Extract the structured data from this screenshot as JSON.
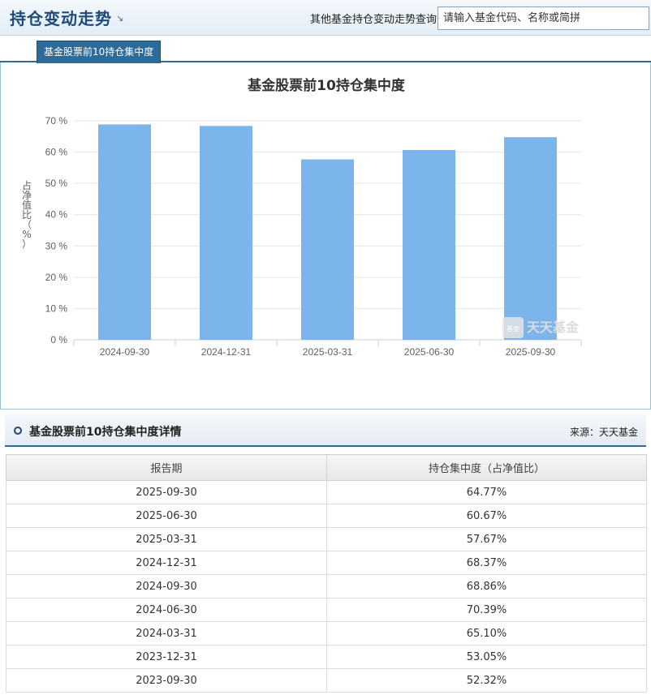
{
  "header": {
    "title": "持仓变动走势",
    "arrow": "↘",
    "query_label": "其他基金持仓变动走势查询:",
    "search_placeholder": "请输入基金代码、名称或简拼"
  },
  "tabs": [
    {
      "label": "基金股票前10持仓集中度"
    }
  ],
  "chart": {
    "watermark_text": "天天基金",
    "watermark_sub": "基金"
  },
  "chart_data": {
    "type": "bar",
    "title": "基金股票前10持仓集中度",
    "ylabel": "占净值比（%）",
    "xlabel": "",
    "categories": [
      "2024-09-30",
      "2024-12-31",
      "2025-03-31",
      "2025-06-30",
      "2025-09-30"
    ],
    "values": [
      68.86,
      68.37,
      57.67,
      60.67,
      64.77
    ],
    "ylim": [
      0,
      70
    ],
    "yticks": [
      0,
      10,
      20,
      30,
      40,
      50,
      60,
      70
    ],
    "ytick_labels": [
      "0 %",
      "10 %",
      "20 %",
      "30 %",
      "40 %",
      "50 %",
      "60 %",
      "70 %"
    ],
    "bar_color": "#7cb5ec",
    "grid": true
  },
  "detail": {
    "title": "基金股票前10持仓集中度详情",
    "source": "来源：天天基金",
    "columns": [
      "报告期",
      "持仓集中度（占净值比）"
    ],
    "rows": [
      [
        "2025-09-30",
        "64.77%"
      ],
      [
        "2025-06-30",
        "60.67%"
      ],
      [
        "2025-03-31",
        "57.67%"
      ],
      [
        "2024-12-31",
        "68.37%"
      ],
      [
        "2024-09-30",
        "68.86%"
      ],
      [
        "2024-06-30",
        "70.39%"
      ],
      [
        "2024-03-31",
        "65.10%"
      ],
      [
        "2023-12-31",
        "53.05%"
      ],
      [
        "2023-09-30",
        "52.32%"
      ]
    ]
  }
}
